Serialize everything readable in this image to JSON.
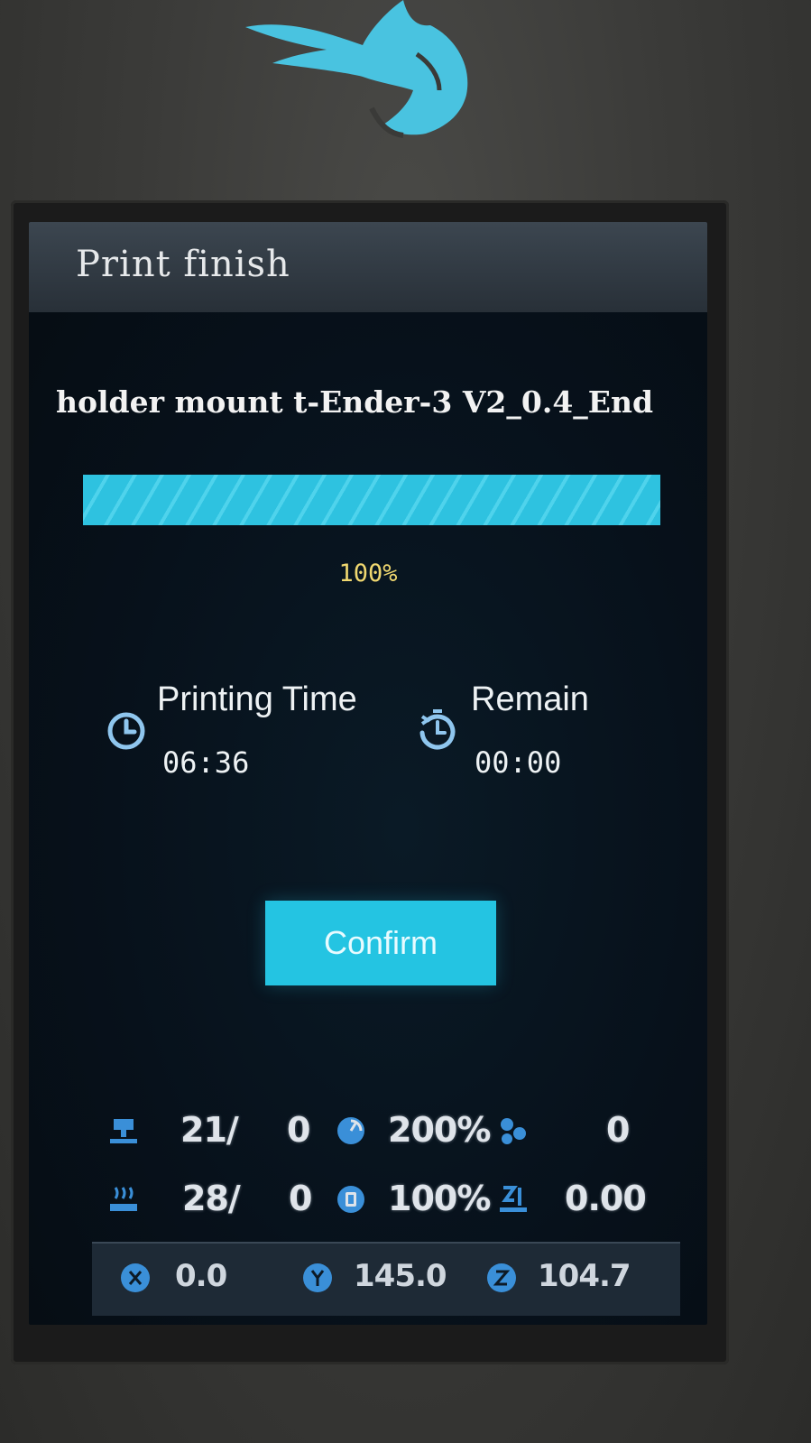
{
  "header": {
    "title": "Print finish"
  },
  "file": {
    "name": "holder mount t-Ender-3 V2_0.4_End"
  },
  "progress": {
    "percent": 100,
    "label": "100%"
  },
  "printing_time": {
    "label": "Printing Time",
    "value": "06:36",
    "icon": "clock-icon"
  },
  "remain": {
    "label": "Remain",
    "value": "00:00",
    "icon": "timer-icon"
  },
  "confirm": {
    "label": "Confirm"
  },
  "status": {
    "nozzle": {
      "icon": "nozzle-temp-icon",
      "value": "21/",
      "target": "0"
    },
    "speed": {
      "icon": "speed-icon",
      "value": "200%"
    },
    "fan": {
      "icon": "fan-icon",
      "value": "0"
    },
    "bed": {
      "icon": "bed-temp-icon",
      "value": "28/",
      "target": "0"
    },
    "flow": {
      "icon": "flow-icon",
      "value": "100%"
    },
    "zoffset": {
      "icon": "z-offset-icon",
      "value": "0.00"
    }
  },
  "axes": {
    "x": {
      "icon": "x-axis-icon",
      "value": "0.0"
    },
    "y": {
      "icon": "y-axis-icon",
      "value": "145.0"
    },
    "z": {
      "icon": "z-axis-icon",
      "value": "104.7"
    }
  },
  "colors": {
    "accent": "#24c4e2",
    "percent_text": "#f0d870",
    "screen_bg": "#07111b",
    "icon_blue": "#3a8fd8"
  }
}
